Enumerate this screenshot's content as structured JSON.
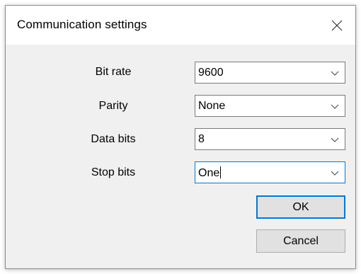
{
  "dialog": {
    "title": "Communication settings",
    "close_icon": "close-icon"
  },
  "fields": [
    {
      "label": "Bit rate",
      "value": "9600"
    },
    {
      "label": "Parity",
      "value": "None"
    },
    {
      "label": "Data bits",
      "value": "8"
    },
    {
      "label": "Stop bits",
      "value": "One"
    }
  ],
  "buttons": {
    "ok_label": "OK",
    "cancel_label": "Cancel"
  },
  "colors": {
    "focus_accent": "#0078d7",
    "dialog_background": "#f0f0f0",
    "title_background": "#ffffff"
  }
}
